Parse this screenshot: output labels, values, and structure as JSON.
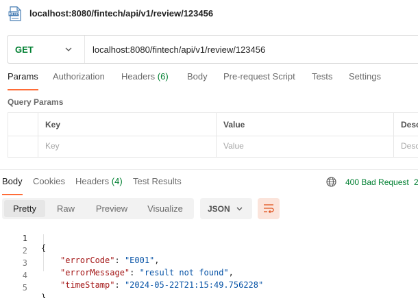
{
  "title": "localhost:8080/fintech/api/v1/review/123456",
  "request": {
    "method": "GET",
    "url": "localhost:8080/fintech/api/v1/review/123456"
  },
  "request_tabs": [
    {
      "label": "Params",
      "active": true
    },
    {
      "label": "Authorization"
    },
    {
      "label": "Headers",
      "count": "(6)"
    },
    {
      "label": "Body"
    },
    {
      "label": "Pre-request Script"
    },
    {
      "label": "Tests"
    },
    {
      "label": "Settings"
    }
  ],
  "query_params": {
    "title": "Query Params",
    "headers": [
      "Key",
      "Value",
      "Desc"
    ],
    "placeholders": [
      "Key",
      "Value",
      "Desc"
    ]
  },
  "response_tabs": [
    {
      "label": "Body",
      "active": true
    },
    {
      "label": "Cookies"
    },
    {
      "label": "Headers",
      "count": "(4)"
    },
    {
      "label": "Test Results"
    }
  ],
  "response_status": {
    "text": "400 Bad Request",
    "extra": "2",
    "color": "#007f31"
  },
  "view_modes": [
    "Pretty",
    "Raw",
    "Preview",
    "Visualize"
  ],
  "active_view": "Pretty",
  "format": "JSON",
  "icons": [
    "http-file-icon",
    "chevron-down-icon",
    "globe-icon",
    "wrap-lines-icon"
  ],
  "accent_color": "#ff6c37",
  "response_body": {
    "line_numbers": [
      "1",
      "2",
      "3",
      "4",
      "5"
    ],
    "open_brace": "{",
    "close_brace": "}",
    "lines": [
      {
        "key": "\"errorCode\"",
        "value": "\"E001\"",
        "comma": ","
      },
      {
        "key": "\"errorMessage\"",
        "value": "\"result not found\"",
        "comma": ","
      },
      {
        "key": "\"timeStamp\"",
        "value": "\"2024-05-22T21:15:49.756228\"",
        "comma": ""
      }
    ]
  }
}
